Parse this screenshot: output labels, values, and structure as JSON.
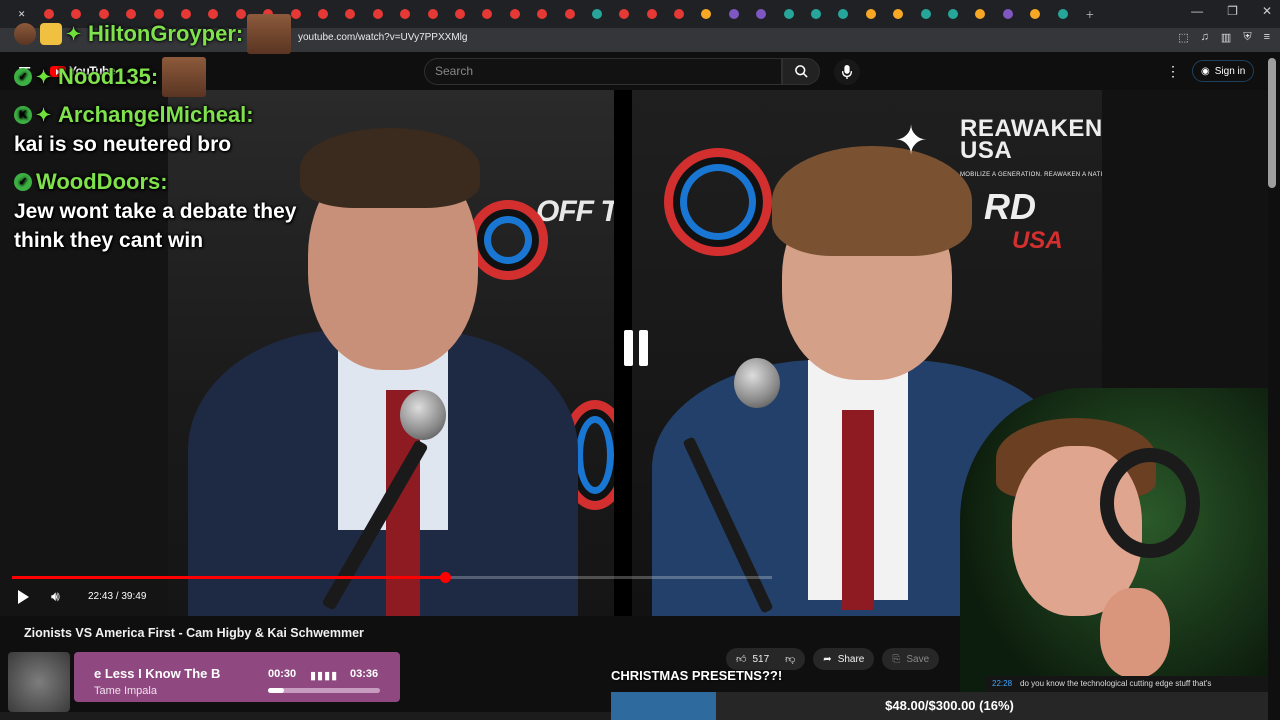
{
  "browser": {
    "url": "youtube.com/watch?v=UVy7PPXXMlg",
    "tab_count": 40
  },
  "youtube": {
    "logo": "YouTube",
    "search_placeholder": "Search",
    "sign_in": "Sign in"
  },
  "video": {
    "title": "Zionists VS America First - Cam Higby & Kai Schwemmer",
    "current_time": "22:43",
    "duration": "39:49",
    "time_display": "22:43 / 39:49",
    "progress_fraction": 0.57,
    "brand_left": "OFF THE RE",
    "brand_right_top": "REAWAKEN",
    "brand_right_usa": "USA",
    "brand_right_tagline": "MOBILIZE A GENERATION. REAWAKEN A NATION.",
    "brand_right_lower": "RD",
    "brand_right_lower_usa": "USA"
  },
  "actions": {
    "likes": "517",
    "share": "Share",
    "save": "Save"
  },
  "chat": {
    "top_name": "HiltonGroyper:",
    "messages": [
      {
        "user": "Nood135:",
        "text": ""
      },
      {
        "user": "ArchangelMicheal:",
        "text": "kai is so neutered bro"
      },
      {
        "user": "WoodDoors:",
        "text": "Jew wont take a debate they think they cant win"
      }
    ]
  },
  "music": {
    "song": "e Less I Know The B",
    "artist": "Tame Impala",
    "elapsed": "00:30",
    "total": "03:36",
    "progress_fraction": 0.14
  },
  "overlay": {
    "banner": "CHRISTMAS PRESETNS??!",
    "goal_text": "$48.00/$300.00 (16%)",
    "goal_fraction": 0.16,
    "subtitle_timestamp": "22:28",
    "subtitle_text": "do you know the technological cutting edge stuff that's"
  }
}
